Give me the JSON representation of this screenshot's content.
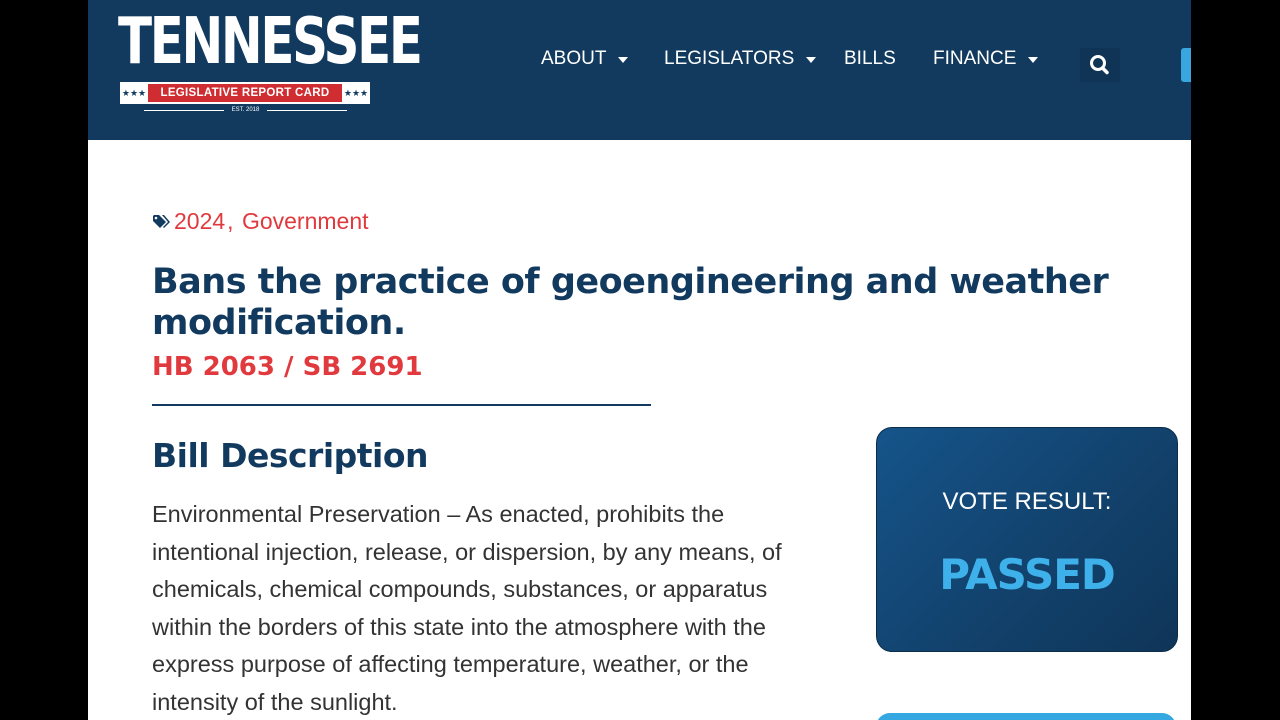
{
  "header": {
    "logo": {
      "title": "TENNESSEE",
      "banner": "LEGISLATIVE REPORT CARD",
      "stars": "★★★",
      "est": "EST. 2018"
    },
    "nav": [
      {
        "label": "ABOUT",
        "has_dropdown": true
      },
      {
        "label": "LEGISLATORS",
        "has_dropdown": true
      },
      {
        "label": "BILLS",
        "has_dropdown": false
      },
      {
        "label": "FINANCE",
        "has_dropdown": true
      }
    ],
    "search_icon": "search-icon"
  },
  "article": {
    "tags": [
      "2024",
      "Government"
    ],
    "tag_separator": ", ",
    "title": "Bans the practice of geoengineering and weather modification.",
    "bill_numbers": "HB 2063 / SB 2691",
    "description_heading": "Bill Description",
    "description": "Environmental Preservation – As enacted, prohibits the intentional injection, release, or dispersion, by any means, of chemicals, chemical compounds, substances, or apparatus within the borders of this state into the atmosphere with the express purpose of affecting temperature, weather, or the intensity of the sunlight."
  },
  "vote": {
    "label": "VOTE RESULT:",
    "result": "PASSED"
  },
  "colors": {
    "navy": "#123a5f",
    "accent_red": "#e03a3e",
    "accent_blue": "#3fb1ea"
  }
}
